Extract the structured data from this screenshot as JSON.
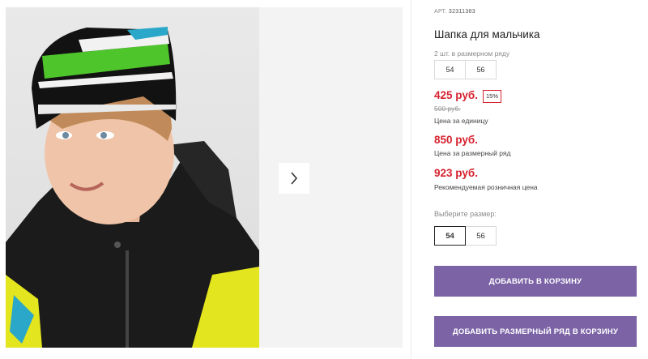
{
  "product": {
    "sku_label": "АРТ.",
    "sku_value": "32311383",
    "title": "Шапка для мальчика"
  },
  "size_row": {
    "label": "2 шт. в размерном ряду",
    "sizes": [
      "54",
      "56"
    ]
  },
  "prices": {
    "unit_price": "425 руб.",
    "discount": "15%",
    "old_price": "500 руб.",
    "unit_caption": "Цена за единицу",
    "row_price": "850 руб.",
    "row_caption": "Цена за размерный ряд",
    "retail_price": "923 руб.",
    "retail_caption": "Рекомендуемая розничная цена"
  },
  "size_select": {
    "label": "Выберите размер:",
    "options": [
      "54",
      "56"
    ],
    "selected": "54"
  },
  "buttons": {
    "add_to_cart": "ДОБАВИТЬ В КОРЗИНУ",
    "add_row_to_cart": "ДОБАВИТЬ РАЗМЕРНЫЙ РЯД В КОРЗИНУ"
  },
  "gallery": {
    "next_icon": "chevron-right-icon"
  },
  "colors": {
    "accent": "#7b63a6",
    "price": "#d6222f"
  }
}
